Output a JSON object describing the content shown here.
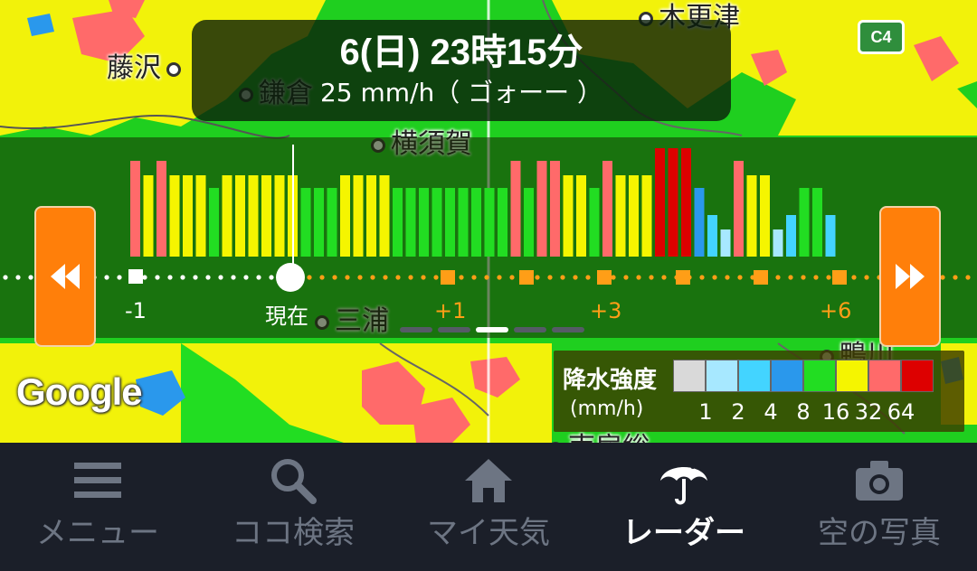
{
  "time_header": {
    "datetime": "6(日) 23時15分",
    "intensity": "25 mm/h（ ゴォーー ）"
  },
  "map": {
    "places": [
      "藤沢",
      "鎌倉",
      "横須賀",
      "三浦",
      "木更津",
      "鴨川",
      "南房総"
    ],
    "road_sign": "C4",
    "attribution": "Google"
  },
  "timeline": {
    "labels": {
      "minus1": "-1",
      "now": "現在",
      "plus1": "+1",
      "plus3": "+3",
      "plus6": "+6"
    },
    "bars": [
      {
        "level": 32
      },
      {
        "level": 16
      },
      {
        "level": 32
      },
      {
        "level": 16
      },
      {
        "level": 16
      },
      {
        "level": 16
      },
      {
        "level": 8
      },
      {
        "level": 16
      },
      {
        "level": 16
      },
      {
        "level": 16
      },
      {
        "level": 16
      },
      {
        "level": 16
      },
      {
        "level": 16
      },
      {
        "level": 8
      },
      {
        "level": 8
      },
      {
        "level": 8
      },
      {
        "level": 16
      },
      {
        "level": 16
      },
      {
        "level": 16
      },
      {
        "level": 16
      },
      {
        "level": 8
      },
      {
        "level": 8
      },
      {
        "level": 8
      },
      {
        "level": 8
      },
      {
        "level": 8
      },
      {
        "level": 8
      },
      {
        "level": 8
      },
      {
        "level": 8
      },
      {
        "level": 8
      },
      {
        "level": 32
      },
      {
        "level": 8
      },
      {
        "level": 32
      },
      {
        "level": 32
      },
      {
        "level": 16
      },
      {
        "level": 16
      },
      {
        "level": 8
      },
      {
        "level": 32
      },
      {
        "level": 16
      },
      {
        "level": 16
      },
      {
        "level": 16
      },
      {
        "level": 64
      },
      {
        "level": 64
      },
      {
        "level": 64
      },
      {
        "level": 8
      },
      {
        "level": 4
      },
      {
        "level": 2
      },
      {
        "level": 32
      },
      {
        "level": 16
      },
      {
        "level": 16
      },
      {
        "level": 2
      },
      {
        "level": 4
      },
      {
        "level": 8
      },
      {
        "level": 8
      },
      {
        "level": 4
      }
    ],
    "now_index": 12,
    "prev_button": "rewind-icon",
    "next_button": "fast-forward-icon",
    "page_count": 5,
    "active_page": 2
  },
  "legend": {
    "title": "降水強度",
    "unit": "(mm/h)",
    "values": [
      "1",
      "2",
      "4",
      "8",
      "16",
      "32",
      "64"
    ],
    "colors": [
      "#d9d9d9",
      "#a7e8ff",
      "#43d4ff",
      "#2a98ec",
      "#22dd22",
      "#f5f500",
      "#ff6a6a",
      "#dd0000"
    ]
  },
  "bottom_nav": [
    {
      "label": "メニュー",
      "icon": "menu-icon",
      "active": false
    },
    {
      "label": "ココ検索",
      "icon": "search-icon",
      "active": false
    },
    {
      "label": "マイ天気",
      "icon": "home-icon",
      "active": false
    },
    {
      "label": "レーダー",
      "icon": "umbrella-rain-icon",
      "active": true
    },
    {
      "label": "空の写真",
      "icon": "camera-icon",
      "active": false
    }
  ]
}
